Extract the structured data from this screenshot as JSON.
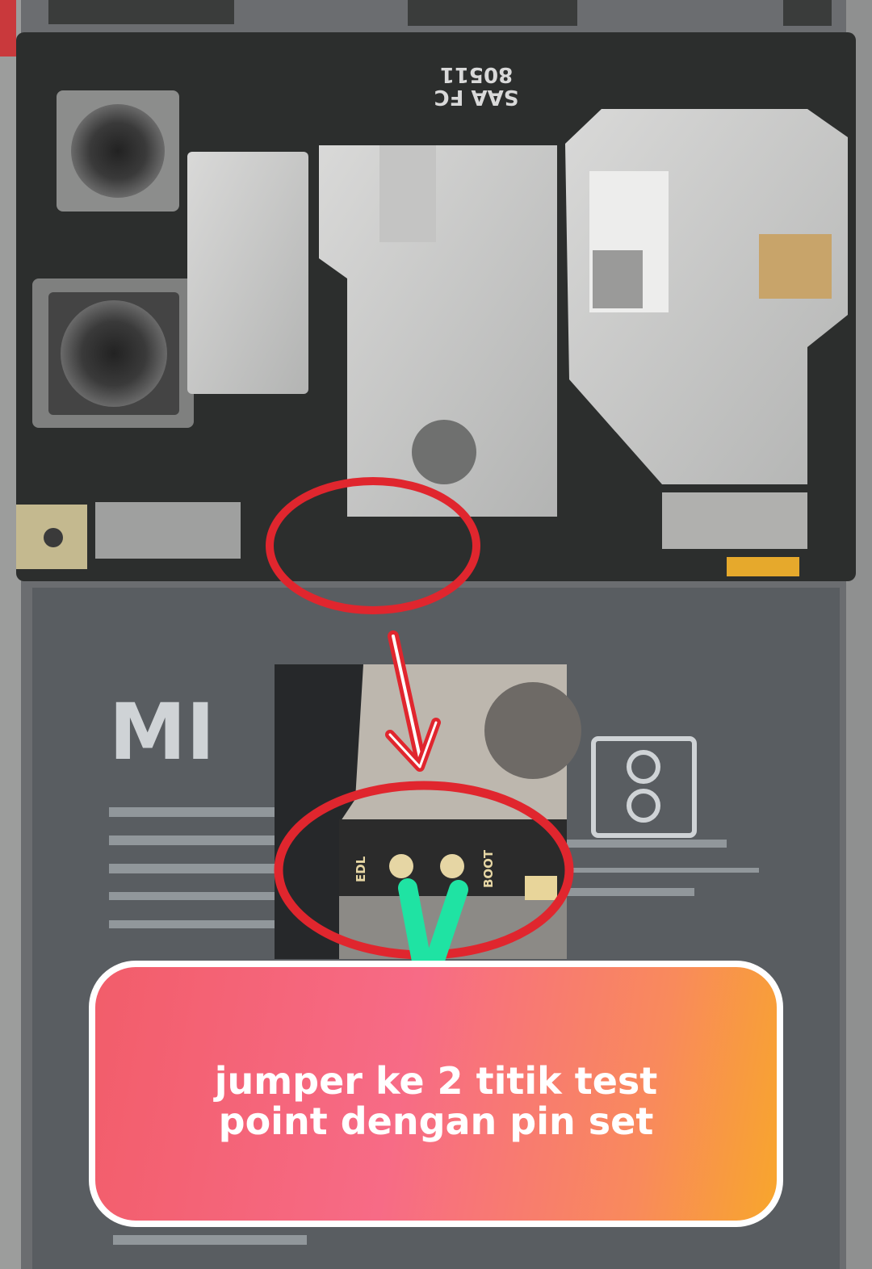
{
  "image": {
    "description_subject": "phone-logic-board-photo",
    "battery_brand": "MI",
    "board_marking": "SAA FC 80511",
    "inset_labels": {
      "left_pad": "EDL",
      "right_pad": "BOOT"
    }
  },
  "caption": {
    "text": "jumper ke 2 titik test point dengan pin set"
  },
  "colors": {
    "circle": "#e0262e",
    "arrow": "#e0262e",
    "check": "#1fe3a3",
    "caption_gradient_start": "#f25d6a",
    "caption_gradient_end": "#f8a62c",
    "caption_border": "#ffffff"
  },
  "icons": {
    "arrow": "arrow-down-icon",
    "check": "v-mark-icon",
    "highlight": "red-circle-icon"
  }
}
